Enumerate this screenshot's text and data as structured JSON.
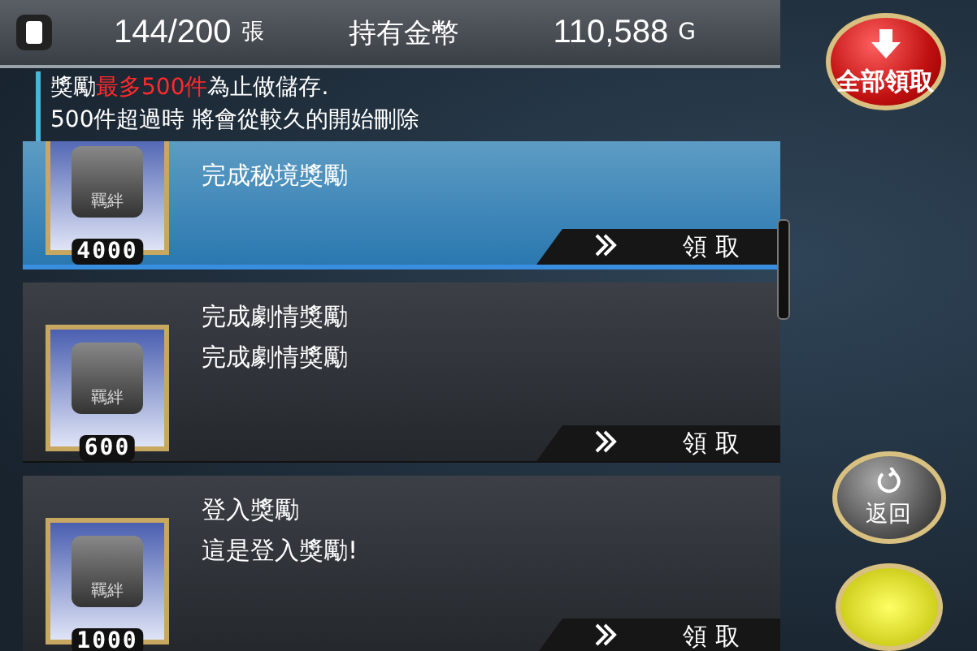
{
  "header": {
    "count": "144/200",
    "count_unit": "張",
    "gold_label": "持有金幣",
    "gold": "110,588",
    "gold_unit": "G"
  },
  "notice": {
    "line1": "獎勵**最多500件**為止做儲存.",
    "line2": "500件超過時  將會從較久的開始刪除"
  },
  "claim_all": {
    "label": "全部領取"
  },
  "rewards": [
    {
      "title": "完成秘境獎勵",
      "icon_label": "羈絆",
      "quantity": "4000",
      "claim": "領 取",
      "selected": true
    },
    {
      "title": "完成劇情獎勵",
      "description": "完成劇情獎勵",
      "icon_label": "羈絆",
      "quantity": "600",
      "claim": "領 取",
      "selected": false
    },
    {
      "title": "登入獎勵",
      "description": "這是登入獎勵!",
      "icon_label": "羈絆",
      "quantity": "1000",
      "claim": "領 取",
      "selected": false
    }
  ],
  "back": {
    "label": "返回"
  }
}
